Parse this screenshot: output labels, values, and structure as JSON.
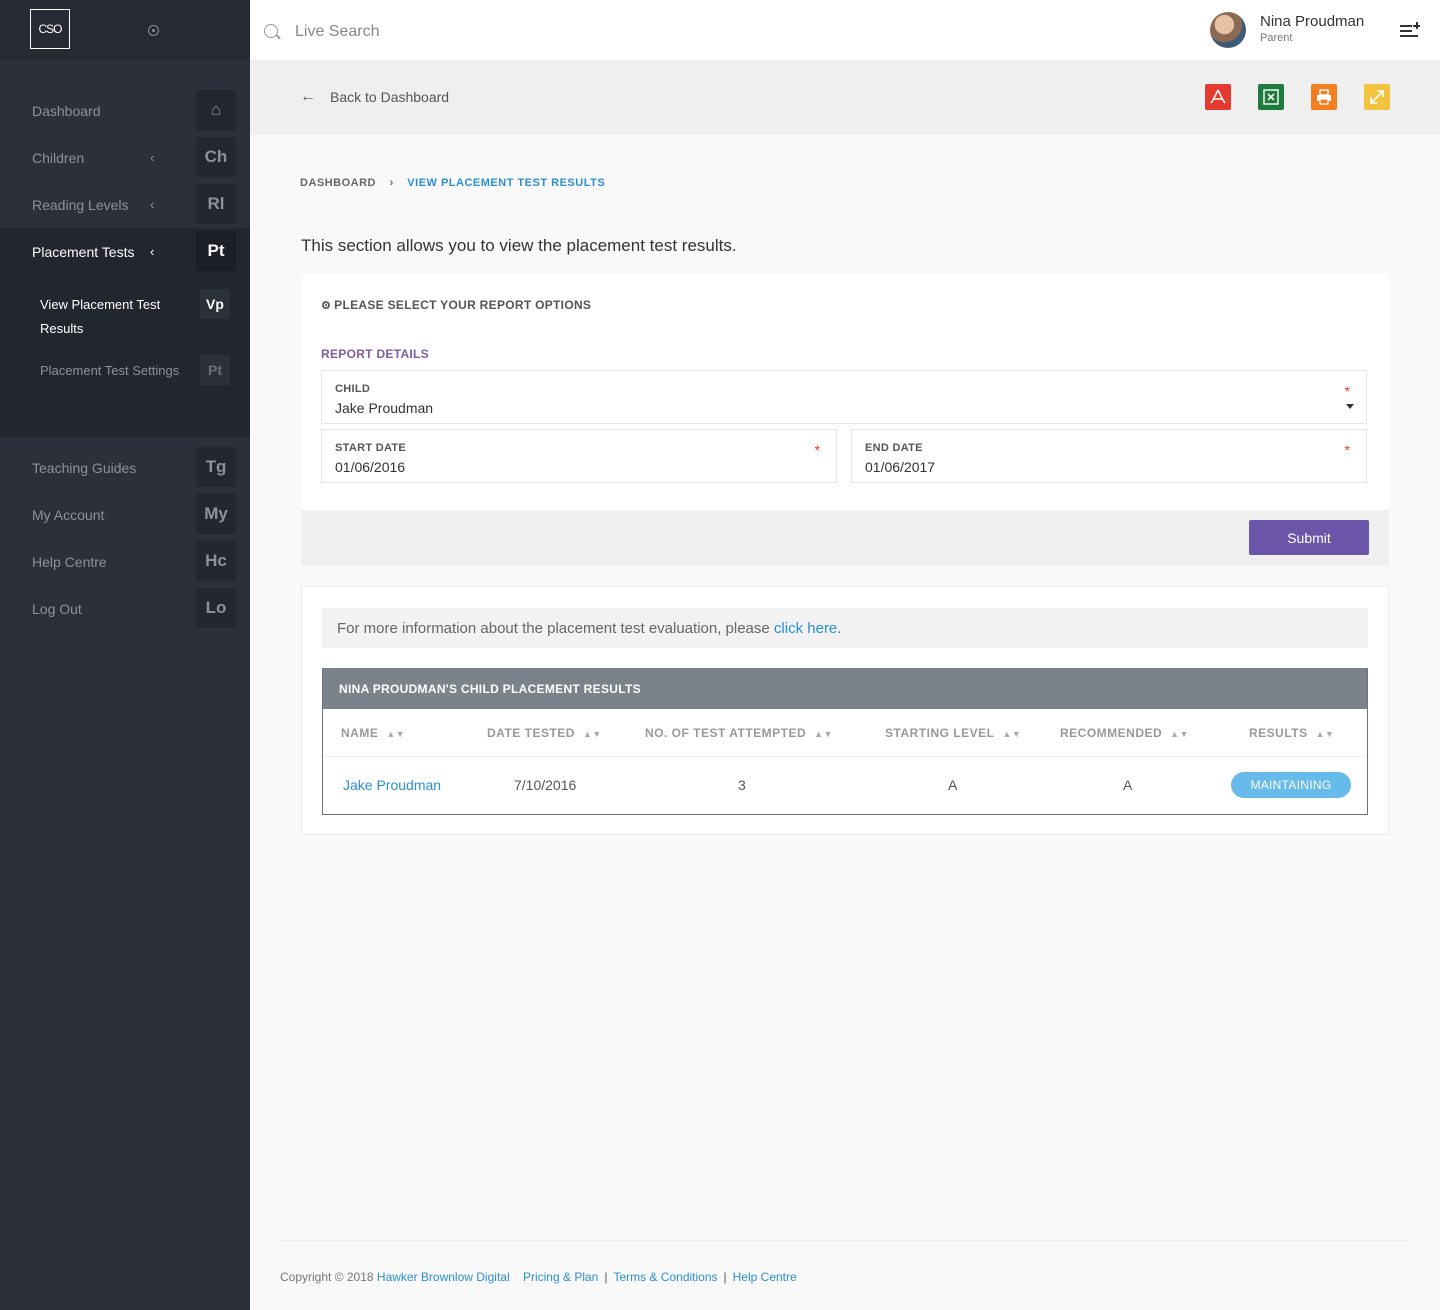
{
  "sidebar": {
    "logo": "CSO",
    "items": [
      {
        "label": "Dashboard",
        "abbr": "⌂",
        "chevron": ""
      },
      {
        "label": "Children",
        "abbr": "Ch",
        "chevron": "‹"
      },
      {
        "label": "Reading Levels",
        "abbr": "Rl",
        "chevron": "‹"
      },
      {
        "label": "Placement Tests",
        "abbr": "Pt",
        "chevron": "‹"
      }
    ],
    "subitems": [
      {
        "label": "View Placement Test Results",
        "abbr": "Vp"
      },
      {
        "label": "Placement Test Settings",
        "abbr": "Pt"
      }
    ],
    "items_after": [
      {
        "label": "Teaching Guides",
        "abbr": "Tg"
      },
      {
        "label": "My Account",
        "abbr": "My"
      },
      {
        "label": "Help Centre",
        "abbr": "Hc"
      },
      {
        "label": "Log Out",
        "abbr": "Lo"
      }
    ]
  },
  "topbar": {
    "search_placeholder": "Live Search",
    "user_name": "Nina Proudman",
    "user_role": "Parent"
  },
  "actionbar": {
    "back_label": "Back to Dashboard",
    "exports": [
      {
        "icon": "pdf-icon",
        "color": "#e53a2f"
      },
      {
        "icon": "excel-icon",
        "color": "#1e7a3d"
      },
      {
        "icon": "print-icon",
        "color": "#f47f20"
      },
      {
        "icon": "expand-icon",
        "color": "#f4c33d"
      }
    ]
  },
  "breadcrumb": {
    "home": "DASHBOARD",
    "current": "VIEW PLACEMENT TEST RESULTS"
  },
  "intro": "This section allows you to view the placement test results.",
  "report": {
    "heading": "PLEASE SELECT YOUR REPORT OPTIONS",
    "section": "REPORT DETAILS",
    "child_label": "CHILD",
    "child_value": "Jake Proudman",
    "start_label": "START DATE",
    "start_value": "01/06/2016",
    "end_label": "END DATE",
    "end_value": "01/06/2017",
    "required_mark": "*",
    "submit_label": "Submit"
  },
  "info": {
    "text": "For more information about the placement test evaluation, please ",
    "link": "click here",
    "tail": "."
  },
  "results": {
    "title": "NINA PROUDMAN'S CHILD PLACEMENT RESULTS",
    "columns": [
      "NAME",
      "DATE TESTED",
      "NO. OF TEST ATTEMPTED",
      "STARTING LEVEL",
      "RECOMMENDED",
      "RESULTS"
    ],
    "rows": [
      {
        "name": "Jake Proudman",
        "date": "7/10/2016",
        "attempts": "3",
        "starting": "A",
        "recommended": "A",
        "result": "MAINTAINING"
      }
    ]
  },
  "footer": {
    "copyright": "Copyright © 2018 ",
    "company": "Hawker Brownlow Digital",
    "links": [
      "Pricing & Plan",
      "Terms & Conditions",
      "Help Centre"
    ]
  },
  "colors": {
    "accent": "#6b55a8",
    "link": "#2a8fd0",
    "badge": "#66bbea",
    "sidebar": "#2c303a"
  }
}
